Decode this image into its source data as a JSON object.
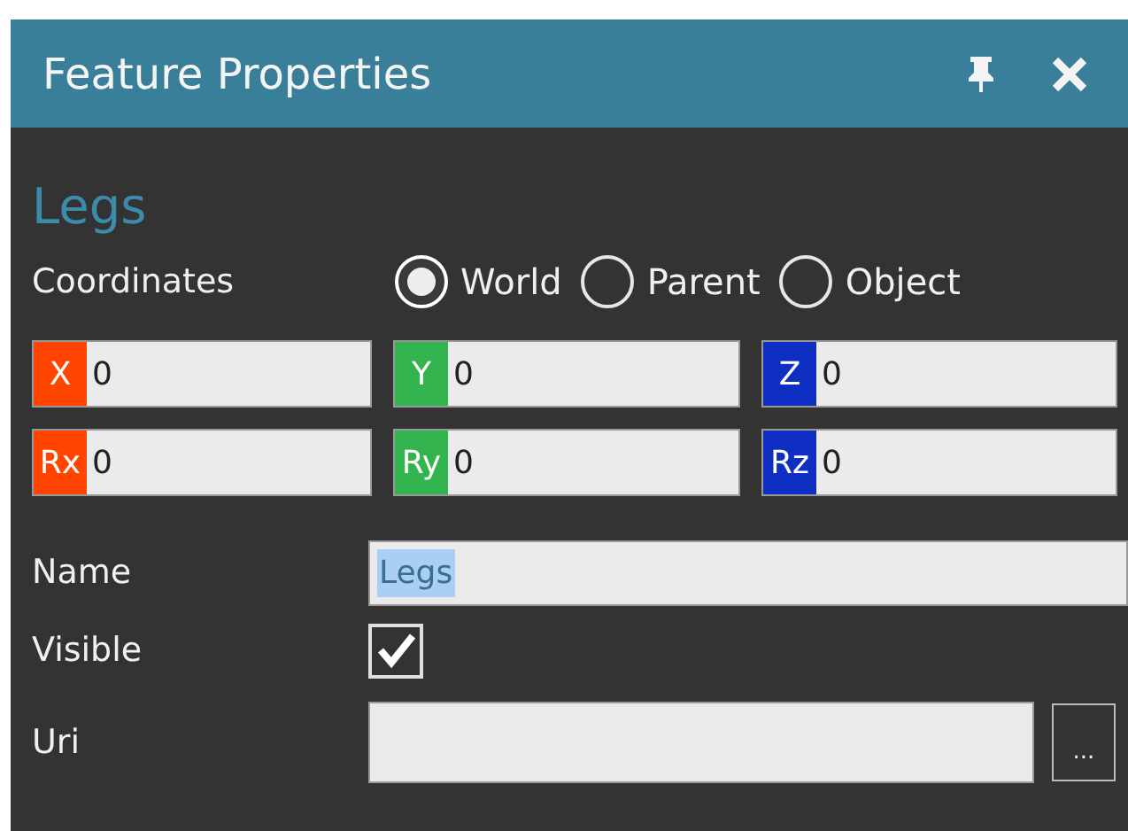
{
  "window": {
    "title": "Feature Properties"
  },
  "heading": "Legs",
  "coordinates": {
    "label": "Coordinates",
    "options": [
      {
        "label": "World",
        "selected": true
      },
      {
        "label": "Parent",
        "selected": false
      },
      {
        "label": "Object",
        "selected": false
      }
    ]
  },
  "transform_fields": [
    {
      "label": "X",
      "value": "0",
      "color": "#ff4500"
    },
    {
      "label": "Y",
      "value": "0",
      "color": "#34b44f"
    },
    {
      "label": "Z",
      "value": "0",
      "color": "#0f2fc3"
    },
    {
      "label": "Rx",
      "value": "0",
      "color": "#ff4500"
    },
    {
      "label": "Ry",
      "value": "0",
      "color": "#34b44f"
    },
    {
      "label": "Rz",
      "value": "0",
      "color": "#0f2fc3"
    }
  ],
  "name": {
    "label": "Name",
    "value": "Legs",
    "text_selected": true
  },
  "visible": {
    "label": "Visible",
    "checked": true
  },
  "uri": {
    "label": "Uri",
    "browse_button": "..."
  }
}
